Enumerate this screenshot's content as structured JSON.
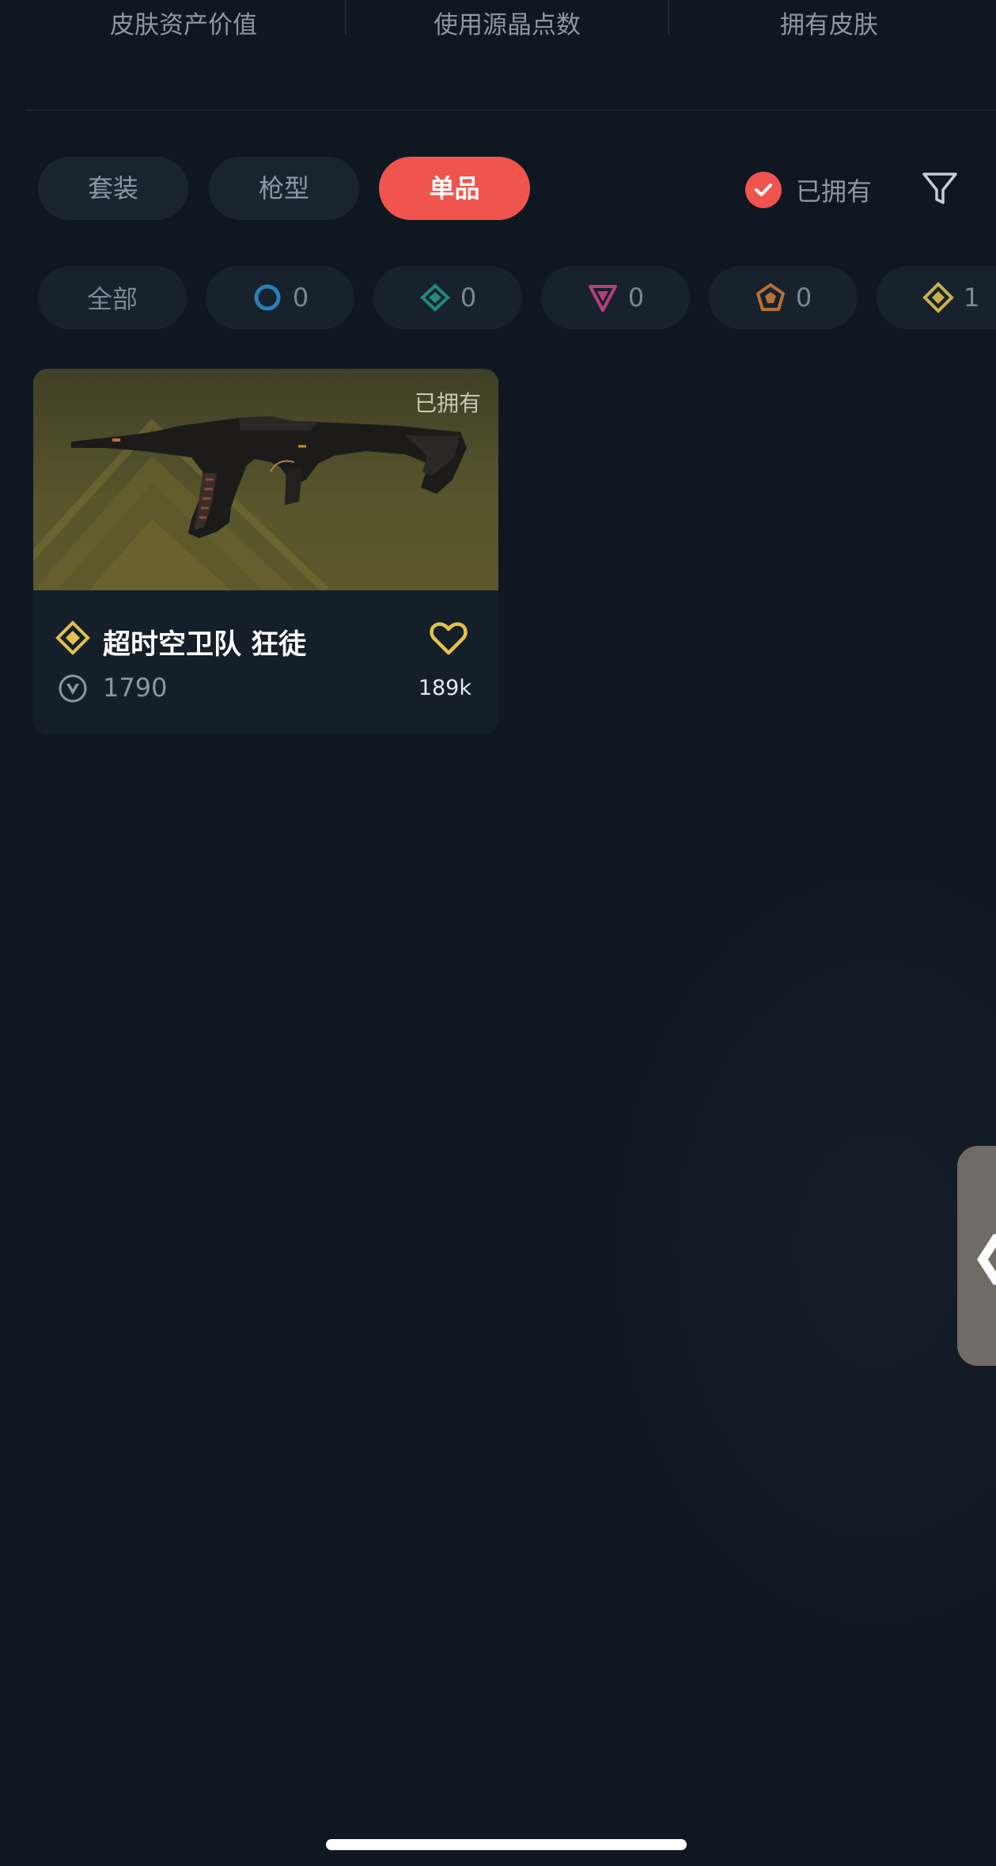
{
  "stats": {
    "labels": [
      "皮肤资产价值",
      "使用源晶点数",
      "拥有皮肤"
    ]
  },
  "tabs": [
    {
      "label": "套装",
      "active": false
    },
    {
      "label": "枪型",
      "active": false
    },
    {
      "label": "单品",
      "active": true
    }
  ],
  "owned_filter": {
    "label": "已拥有",
    "checked": true
  },
  "filter_icon": "filter-funnel-icon",
  "rarity_chips": [
    {
      "label": "全部",
      "icon": null
    },
    {
      "label": "0",
      "icon": "select-tier-icon",
      "color": "#2a7fb8"
    },
    {
      "label": "0",
      "icon": "deluxe-tier-icon",
      "color": "#1f8a7e"
    },
    {
      "label": "0",
      "icon": "premium-tier-icon",
      "color": "#b4407a"
    },
    {
      "label": "0",
      "icon": "exclusive-tier-icon",
      "color": "#b3723a"
    },
    {
      "label": "1",
      "icon": "ultra-tier-icon",
      "color": "#c9b04a"
    }
  ],
  "skins": [
    {
      "name": "超时空卫队 狂徒",
      "owned_tag": "已拥有",
      "price": "1790",
      "likes": "189k",
      "tier_icon": "ultra-tier-icon",
      "tier_color": "#e2c24a",
      "heart_color": "#e2c24a"
    }
  ],
  "colors": {
    "background": "#0f1721",
    "accent": "#f0544f",
    "chip_bg": "#18222c"
  },
  "side_handle": {
    "label": "❮"
  }
}
